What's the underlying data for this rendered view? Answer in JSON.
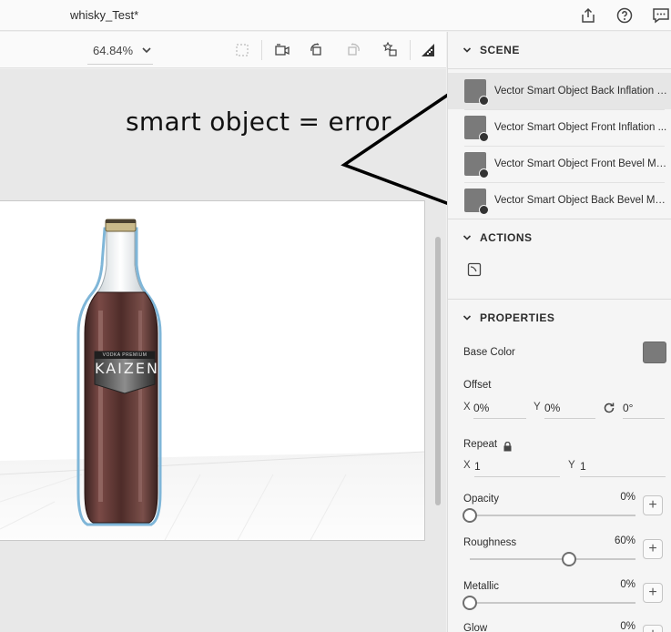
{
  "titlebar": {
    "doc_title": "whisky_Test*",
    "icons": [
      "share-icon",
      "help-icon",
      "feedback-icon"
    ]
  },
  "toolbar": {
    "zoom": "64.84%",
    "tools": [
      "select-icon",
      "camera-icon",
      "orbit-icon",
      "rotate-icon",
      "light-icon",
      "render-icon"
    ]
  },
  "annotation": {
    "text": "smart object = error"
  },
  "scene": {
    "header": "SCENE",
    "items": [
      {
        "label": "Vector Smart Object Back Inflation M..."
      },
      {
        "label": "Vector Smart Object Front Inflation ..."
      },
      {
        "label": "Vector Smart Object Front Bevel Ma..."
      },
      {
        "label": "Vector Smart Object Back Bevel Mat..."
      }
    ]
  },
  "actions": {
    "header": "ACTIONS"
  },
  "properties": {
    "header": "PROPERTIES",
    "base_color": {
      "label": "Base Color",
      "color": "#7a7a7a"
    },
    "offset": {
      "label": "Offset",
      "x_axis": "X",
      "x": "0%",
      "y_axis": "Y",
      "y": "0%",
      "rot": "0°"
    },
    "repeat": {
      "label": "Repeat",
      "x_axis": "X",
      "x": "1",
      "y_axis": "Y",
      "y": "1"
    },
    "opacity": {
      "label": "Opacity",
      "value": "0%",
      "level": 0.0
    },
    "roughness": {
      "label": "Roughness",
      "value": "60%",
      "level": 0.6
    },
    "metallic": {
      "label": "Metallic",
      "value": "0%",
      "level": 0.0
    },
    "glow": {
      "label": "Glow",
      "value": "0%"
    }
  },
  "bottle_label": {
    "brand": "KAIZEN",
    "tagline": "VODKA PREMIUM"
  }
}
